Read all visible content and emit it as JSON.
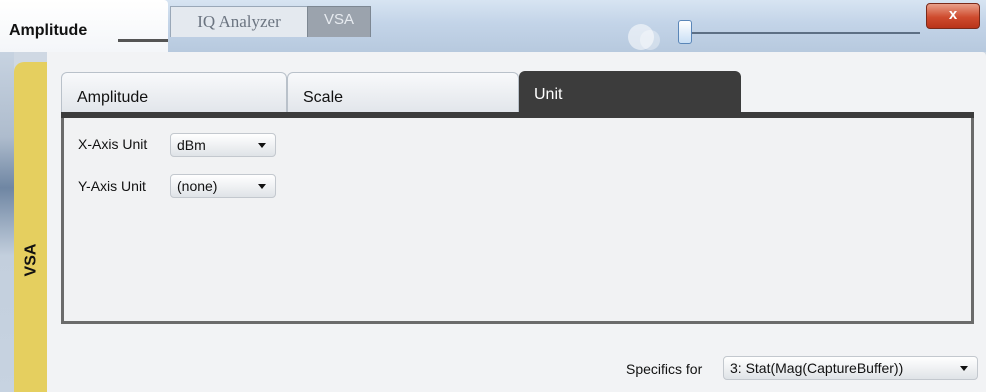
{
  "window": {
    "title": "Amplitude",
    "close_label": "x",
    "background_tabs": [
      "IQ Analyzer",
      "VSA"
    ]
  },
  "side_label": "VSA",
  "tabs": [
    {
      "label": "Amplitude",
      "active": false
    },
    {
      "label": "Scale",
      "active": false
    },
    {
      "label": "Unit",
      "active": true
    }
  ],
  "fields": {
    "x_axis": {
      "label": "X-Axis Unit",
      "value": "dBm"
    },
    "y_axis": {
      "label": "Y-Axis Unit",
      "value": "(none)"
    }
  },
  "specifics": {
    "label": "Specifics for",
    "value": "3: Stat(Mag(CaptureBuffer))"
  },
  "colors": {
    "side_label_bg": "#e5cf5f",
    "active_tab_bg": "#3c3c3c",
    "close_button": "#cf4b2e"
  }
}
